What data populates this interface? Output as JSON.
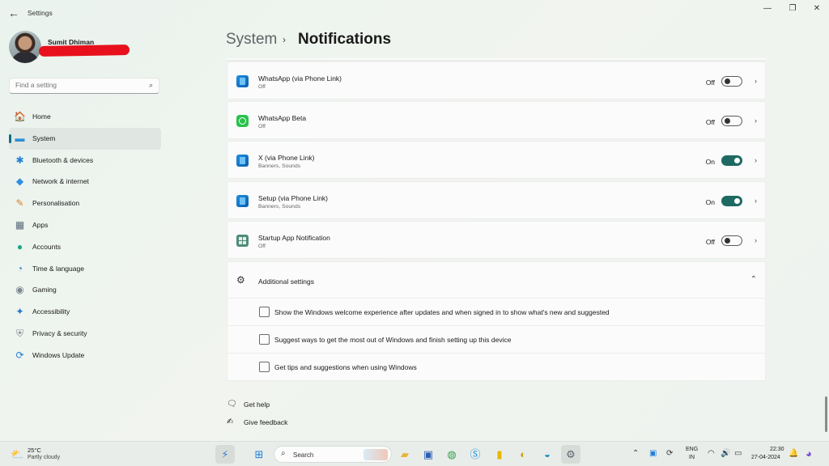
{
  "window": {
    "title": "Settings",
    "back_glyph": "←",
    "minimize_glyph": "—",
    "restore_glyph": "❐",
    "close_glyph": "✕"
  },
  "profile": {
    "name": "Sumit Dhiman"
  },
  "search": {
    "placeholder": "Find a setting",
    "icon": "search-icon"
  },
  "sidebar": {
    "items": [
      {
        "label": "Home",
        "icon": "home-icon",
        "glyph": "🏠",
        "color": "#c9744a",
        "active": false
      },
      {
        "label": "System",
        "icon": "monitor-icon",
        "glyph": "▬",
        "color": "#2b8fd6",
        "active": true
      },
      {
        "label": "Bluetooth & devices",
        "icon": "bluetooth-icon",
        "glyph": "✱",
        "color": "#1e7fd8",
        "active": false
      },
      {
        "label": "Network & internet",
        "icon": "wifi-icon",
        "glyph": "◆",
        "color": "#2e8fe0",
        "active": false
      },
      {
        "label": "Personalisation",
        "icon": "brush-icon",
        "glyph": "✎",
        "color": "#d9822b",
        "active": false
      },
      {
        "label": "Apps",
        "icon": "apps-icon",
        "glyph": "▦",
        "color": "#5a6b7a",
        "active": false
      },
      {
        "label": "Accounts",
        "icon": "person-icon",
        "glyph": "●",
        "color": "#1fa68a",
        "active": false
      },
      {
        "label": "Time & language",
        "icon": "globe-clock-icon",
        "glyph": "◔",
        "color": "#2f86c9",
        "active": false
      },
      {
        "label": "Gaming",
        "icon": "gamepad-icon",
        "glyph": "◉",
        "color": "#7a8590",
        "active": false
      },
      {
        "label": "Accessibility",
        "icon": "accessibility-icon",
        "glyph": "✦",
        "color": "#2277c9",
        "active": false
      },
      {
        "label": "Privacy & security",
        "icon": "shield-icon",
        "glyph": "⛨",
        "color": "#7d8893",
        "active": false
      },
      {
        "label": "Windows Update",
        "icon": "update-icon",
        "glyph": "⟳",
        "color": "#1f7fd4",
        "active": false
      }
    ]
  },
  "header": {
    "section": "System",
    "separator": "›",
    "page": "Notifications"
  },
  "apps": [
    {
      "name": "WhatsApp (via Phone Link)",
      "sub": "Off",
      "state": "Off",
      "on": false,
      "icon": "phonelink-app-icon",
      "kind": "phonelink"
    },
    {
      "name": "WhatsApp Beta",
      "sub": "Off",
      "state": "Off",
      "on": false,
      "icon": "whatsapp-icon",
      "kind": "whatsapp"
    },
    {
      "name": "X (via Phone Link)",
      "sub": "Banners, Sounds",
      "state": "On",
      "on": true,
      "icon": "phonelink-app-icon",
      "kind": "phonelink"
    },
    {
      "name": "Setup (via Phone Link)",
      "sub": "Banners, Sounds",
      "state": "On",
      "on": true,
      "icon": "phonelink-app-icon",
      "kind": "phonelink"
    },
    {
      "name": "Startup App Notification",
      "sub": "Off",
      "state": "Off",
      "on": false,
      "icon": "startup-app-icon",
      "kind": "startup"
    }
  ],
  "additional": {
    "title": "Additional settings",
    "icon": "gears-icon",
    "expanded_glyph": "⌃",
    "options": [
      {
        "label": "Show the Windows welcome experience after updates and when signed in to show what's new and suggested",
        "checked": false
      },
      {
        "label": "Suggest ways to get the most out of Windows and finish setting up this device",
        "checked": false
      },
      {
        "label": "Get tips and suggestions when using Windows",
        "checked": false
      }
    ]
  },
  "links": [
    {
      "label": "Get help",
      "icon": "help-chat-icon",
      "glyph": "🗨"
    },
    {
      "label": "Give feedback",
      "icon": "feedback-icon",
      "glyph": "✍"
    }
  ],
  "taskbar": {
    "weather": {
      "temp": "25°C",
      "desc": "Partly cloudy",
      "icon": "sun-cloud-icon"
    },
    "search_label": "Search",
    "apps": [
      {
        "name": "widgets",
        "glyph": "⚡",
        "color": "#3a7bd5"
      },
      {
        "name": "start",
        "glyph": "⊞",
        "color": "#1f7fd8"
      },
      {
        "name": "file-explorer",
        "glyph": "▰",
        "color": "#e8b53a"
      },
      {
        "name": "store",
        "glyph": "▣",
        "color": "#2b5fb4"
      },
      {
        "name": "chrome",
        "glyph": "◍",
        "color": "#2fa24c"
      },
      {
        "name": "skype",
        "glyph": "Ⓢ",
        "color": "#1592e0"
      },
      {
        "name": "sticky-notes",
        "glyph": "▮",
        "color": "#e4b700"
      },
      {
        "name": "chat-app",
        "glyph": "◐",
        "color": "#c8a020"
      },
      {
        "name": "edge",
        "glyph": "◒",
        "color": "#1b8fc7"
      },
      {
        "name": "settings",
        "glyph": "⚙",
        "color": "#5a6670"
      }
    ],
    "tray": {
      "language_top": "ENG",
      "language_bottom": "IN",
      "time": "22:30",
      "date": "27-04-2024"
    }
  }
}
